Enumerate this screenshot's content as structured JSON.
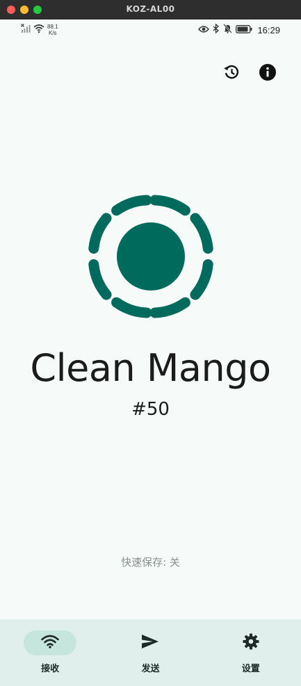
{
  "window": {
    "title": "KOZ-AL00"
  },
  "status_bar": {
    "net_speed_value": "88.1",
    "net_speed_unit": "K/s",
    "time": "16:29",
    "icons": [
      "no-signal-icon",
      "wifi-icon",
      "eye-icon",
      "bluetooth-icon",
      "silent-bell-icon",
      "battery-icon"
    ]
  },
  "top_actions": {
    "icons": [
      "history-icon",
      "info-icon"
    ]
  },
  "device": {
    "name": "Clean Mango",
    "id": "#50"
  },
  "quick_save": {
    "label": "快速保存: 关"
  },
  "bottom_nav": {
    "items": [
      {
        "label": "接收",
        "icon": "wifi-icon",
        "active": true
      },
      {
        "label": "发送",
        "icon": "send-icon",
        "active": false
      },
      {
        "label": "设置",
        "icon": "gear-icon",
        "active": false
      }
    ]
  },
  "colors": {
    "accent": "#006a5c",
    "background": "#f6fbfa",
    "nav_background": "#e0efeb",
    "nav_active_pill": "#c5e5dd"
  }
}
